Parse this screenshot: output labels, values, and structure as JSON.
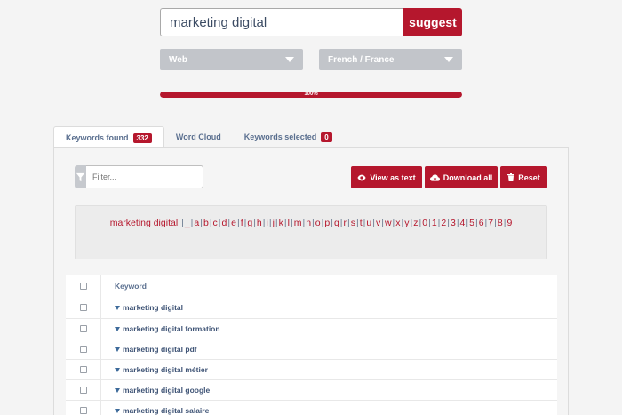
{
  "search": {
    "value": "marketing digital",
    "button_label": "suggest"
  },
  "selects": {
    "source": "Web",
    "language": "French / France"
  },
  "progress": {
    "percent": 100,
    "label": "100%"
  },
  "tabs": [
    {
      "label": "Keywords found",
      "badge": "332"
    },
    {
      "label": "Word Cloud"
    },
    {
      "label": "Keywords selected",
      "badge": "0"
    }
  ],
  "toolbar": {
    "filter_placeholder": "Filter...",
    "view_as_text": "View as text",
    "download_all": "Download all",
    "reset": "Reset"
  },
  "alphabet": {
    "lead": "marketing digital",
    "items": [
      "_",
      "a",
      "b",
      "c",
      "d",
      "e",
      "f",
      "g",
      "h",
      "i",
      "j",
      "k",
      "l",
      "m",
      "n",
      "o",
      "p",
      "q",
      "r",
      "s",
      "t",
      "u",
      "v",
      "w",
      "x",
      "y",
      "z",
      "0",
      "1",
      "2",
      "3",
      "4",
      "5",
      "6",
      "7",
      "8",
      "9"
    ]
  },
  "table": {
    "header": "Keyword",
    "rows": [
      "marketing digital",
      "marketing digital formation",
      "marketing digital pdf",
      "marketing digital métier",
      "marketing digital google",
      "marketing digital salaire"
    ]
  },
  "colors": {
    "accent": "#b5172d",
    "select_bg": "#c2c5ca",
    "link": "#5a6f8f"
  }
}
